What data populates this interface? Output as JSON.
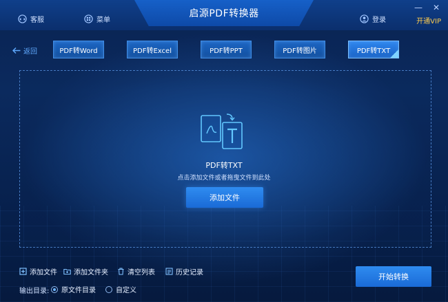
{
  "window": {
    "title": "启源PDF转换器"
  },
  "titlebar": {
    "support_label": "客服",
    "menu_label": "菜单",
    "login_label": "登录",
    "vip_label": "开通VIP",
    "minimize_glyph": "—",
    "close_glyph": "✕"
  },
  "nav": {
    "back_label": "返回",
    "tabs": [
      {
        "label": "PDF转Word"
      },
      {
        "label": "PDF转Excel"
      },
      {
        "label": "PDF转PPT"
      },
      {
        "label": "PDF转图片"
      },
      {
        "label": "PDF转TXT",
        "active": true
      }
    ]
  },
  "dropzone": {
    "icon": "pdf-to-txt-icon",
    "title": "PDF转TXT",
    "hint": "点击添加文件或者拖曳文件到此处",
    "add_button": "添加文件"
  },
  "toolbar": {
    "add_file": "添加文件",
    "add_folder": "添加文件夹",
    "clear_list": "清空列表",
    "history": "历史记录"
  },
  "output": {
    "label": "输出目录:",
    "options": [
      {
        "label": "原文件目录",
        "selected": true
      },
      {
        "label": "自定义",
        "selected": false
      }
    ]
  },
  "start_button": "开始转换",
  "colors": {
    "accent": "#2f8cf0",
    "vip": "#ffcc4d",
    "background": "#0b2a5e"
  }
}
